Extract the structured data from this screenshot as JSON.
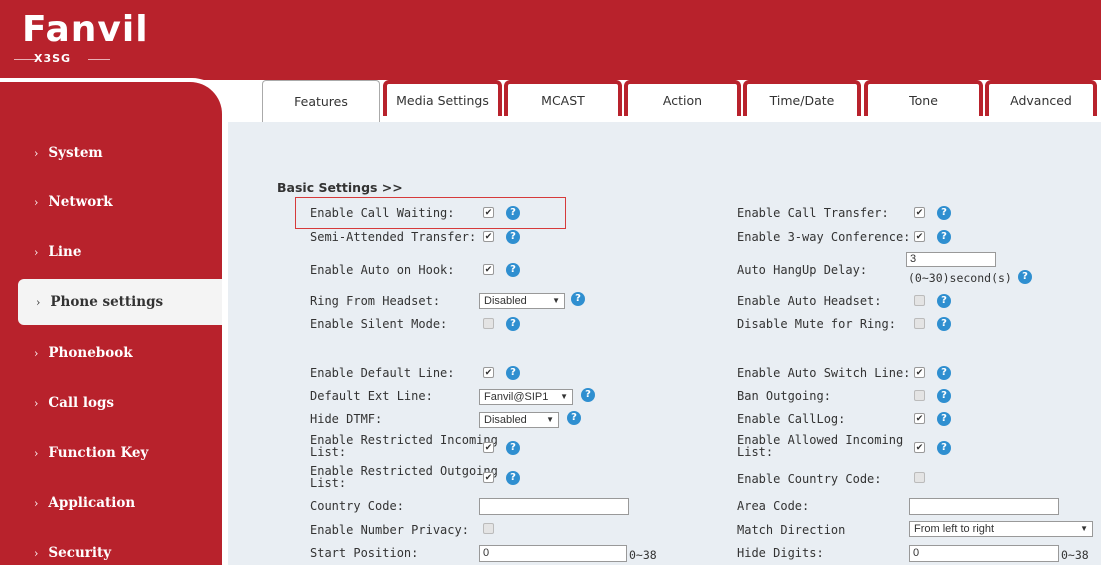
{
  "brand": {
    "logo": "Fanvil",
    "model": "X3SG"
  },
  "tabs": [
    {
      "label": "Features",
      "state": "active"
    },
    {
      "label": "Media Settings"
    },
    {
      "label": "MCAST"
    },
    {
      "label": "Action"
    },
    {
      "label": "Time/Date"
    },
    {
      "label": "Tone"
    },
    {
      "label": "Advanced"
    }
  ],
  "sidebar": {
    "items": [
      {
        "label": "System"
      },
      {
        "label": "Network"
      },
      {
        "label": "Line"
      },
      {
        "label": "Phone settings",
        "active": true
      },
      {
        "label": "Phonebook"
      },
      {
        "label": "Call logs"
      },
      {
        "label": "Function Key"
      },
      {
        "label": "Application"
      },
      {
        "label": "Security"
      }
    ],
    "chevron": "›"
  },
  "section": {
    "title": "Basic Settings >>"
  },
  "left": {
    "call_waiting": {
      "label": "Enable Call Waiting:",
      "checked": true
    },
    "semi_attended": {
      "label": "Semi-Attended Transfer:",
      "checked": true
    },
    "auto_on_hook": {
      "label": "Enable Auto on Hook:",
      "checked": true
    },
    "ring_headset": {
      "label": "Ring From Headset:",
      "value": "Disabled"
    },
    "silent_mode": {
      "label": "Enable Silent Mode:",
      "checked": false
    },
    "default_line": {
      "label": "Enable Default Line:",
      "checked": true
    },
    "default_ext": {
      "label": "Default Ext Line:",
      "value": "Fanvil@SIP1"
    },
    "hide_dtmf": {
      "label": "Hide DTMF:",
      "value": "Disabled"
    },
    "restricted_in": {
      "label_1": "Enable Restricted Incoming",
      "label_2": "List:",
      "checked": true
    },
    "restricted_out": {
      "label_1": "Enable Restricted Outgoing",
      "label_2": "List:",
      "checked": true
    },
    "country_code": {
      "label": "Country Code:",
      "value": ""
    },
    "number_privacy": {
      "label": "Enable Number Privacy:",
      "checked": false
    },
    "start_position": {
      "label": "Start Position:",
      "value": "0",
      "range": "0~38"
    }
  },
  "right": {
    "call_transfer": {
      "label": "Enable Call Transfer:",
      "checked": true
    },
    "three_way": {
      "label": "Enable 3-way Conference:",
      "checked": true
    },
    "auto_hangup": {
      "label": "Auto HangUp Delay:",
      "value": "3",
      "range": "(0~30)second(s)"
    },
    "auto_headset": {
      "label": "Enable Auto Headset:",
      "checked": false
    },
    "mute_ring": {
      "label": "Disable Mute for Ring:",
      "checked": false
    },
    "auto_switch": {
      "label": "Enable Auto Switch Line:",
      "checked": true
    },
    "ban_outgoing": {
      "label": "Ban Outgoing:",
      "checked": false
    },
    "call_log": {
      "label": "Enable CallLog:",
      "checked": true
    },
    "allowed_in": {
      "label_1": "Enable Allowed Incoming",
      "label_2": "List:",
      "checked": true
    },
    "country_code_en": {
      "label": "Enable Country Code:",
      "checked": false
    },
    "area_code": {
      "label": "Area Code:",
      "value": ""
    },
    "match_direction": {
      "label": "Match Direction",
      "value": "From left to right"
    },
    "hide_digits": {
      "label": "Hide Digits:",
      "value": "0",
      "range": "0~38"
    }
  },
  "help_icon": "?",
  "colors": {
    "brand_red": "#b8222c",
    "content_bg": "#e9eef3",
    "help_blue": "#2f8fd0",
    "highlight": "#d63a3a"
  }
}
